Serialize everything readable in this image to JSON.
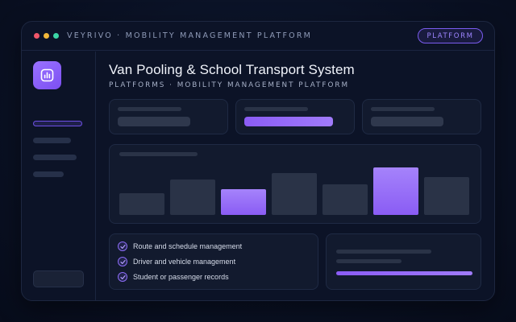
{
  "window": {
    "title": "VEYRIVO · MOBILITY MANAGEMENT PLATFORM",
    "badge": "PLATFORM",
    "traffic_lights": [
      "#f0566a",
      "#f2b83a",
      "#3bd6a6"
    ]
  },
  "sidebar": {
    "logo_icon": "bar-chart-icon",
    "active_item_index": 0,
    "item_count": 4
  },
  "header": {
    "title": "Van Pooling & School Transport  System",
    "subtitle": "PLATFORMS · MOBILITY MANAGEMENT PLATFORM"
  },
  "stat_cards": [
    {
      "highlighted": false
    },
    {
      "highlighted": true
    },
    {
      "highlighted": false
    }
  ],
  "chart_data": {
    "type": "bar",
    "categories": [
      "",
      "",
      "",
      "",
      "",
      "",
      ""
    ],
    "values": [
      27,
      44,
      32,
      52,
      38,
      59,
      47
    ],
    "highlighted_indices": [
      2,
      5
    ],
    "title": "",
    "xlabel": "",
    "ylabel": "",
    "grid": false
  },
  "features": [
    "Route and schedule management",
    "Driver and vehicle management",
    "Student or passenger records"
  ],
  "summary_card": {
    "progress": 1.0
  },
  "colors": {
    "accent": "#8b5cf6",
    "accent_light": "#a78bfa",
    "placeholder": "#2a3347",
    "placeholder_muted": "#232c40"
  }
}
